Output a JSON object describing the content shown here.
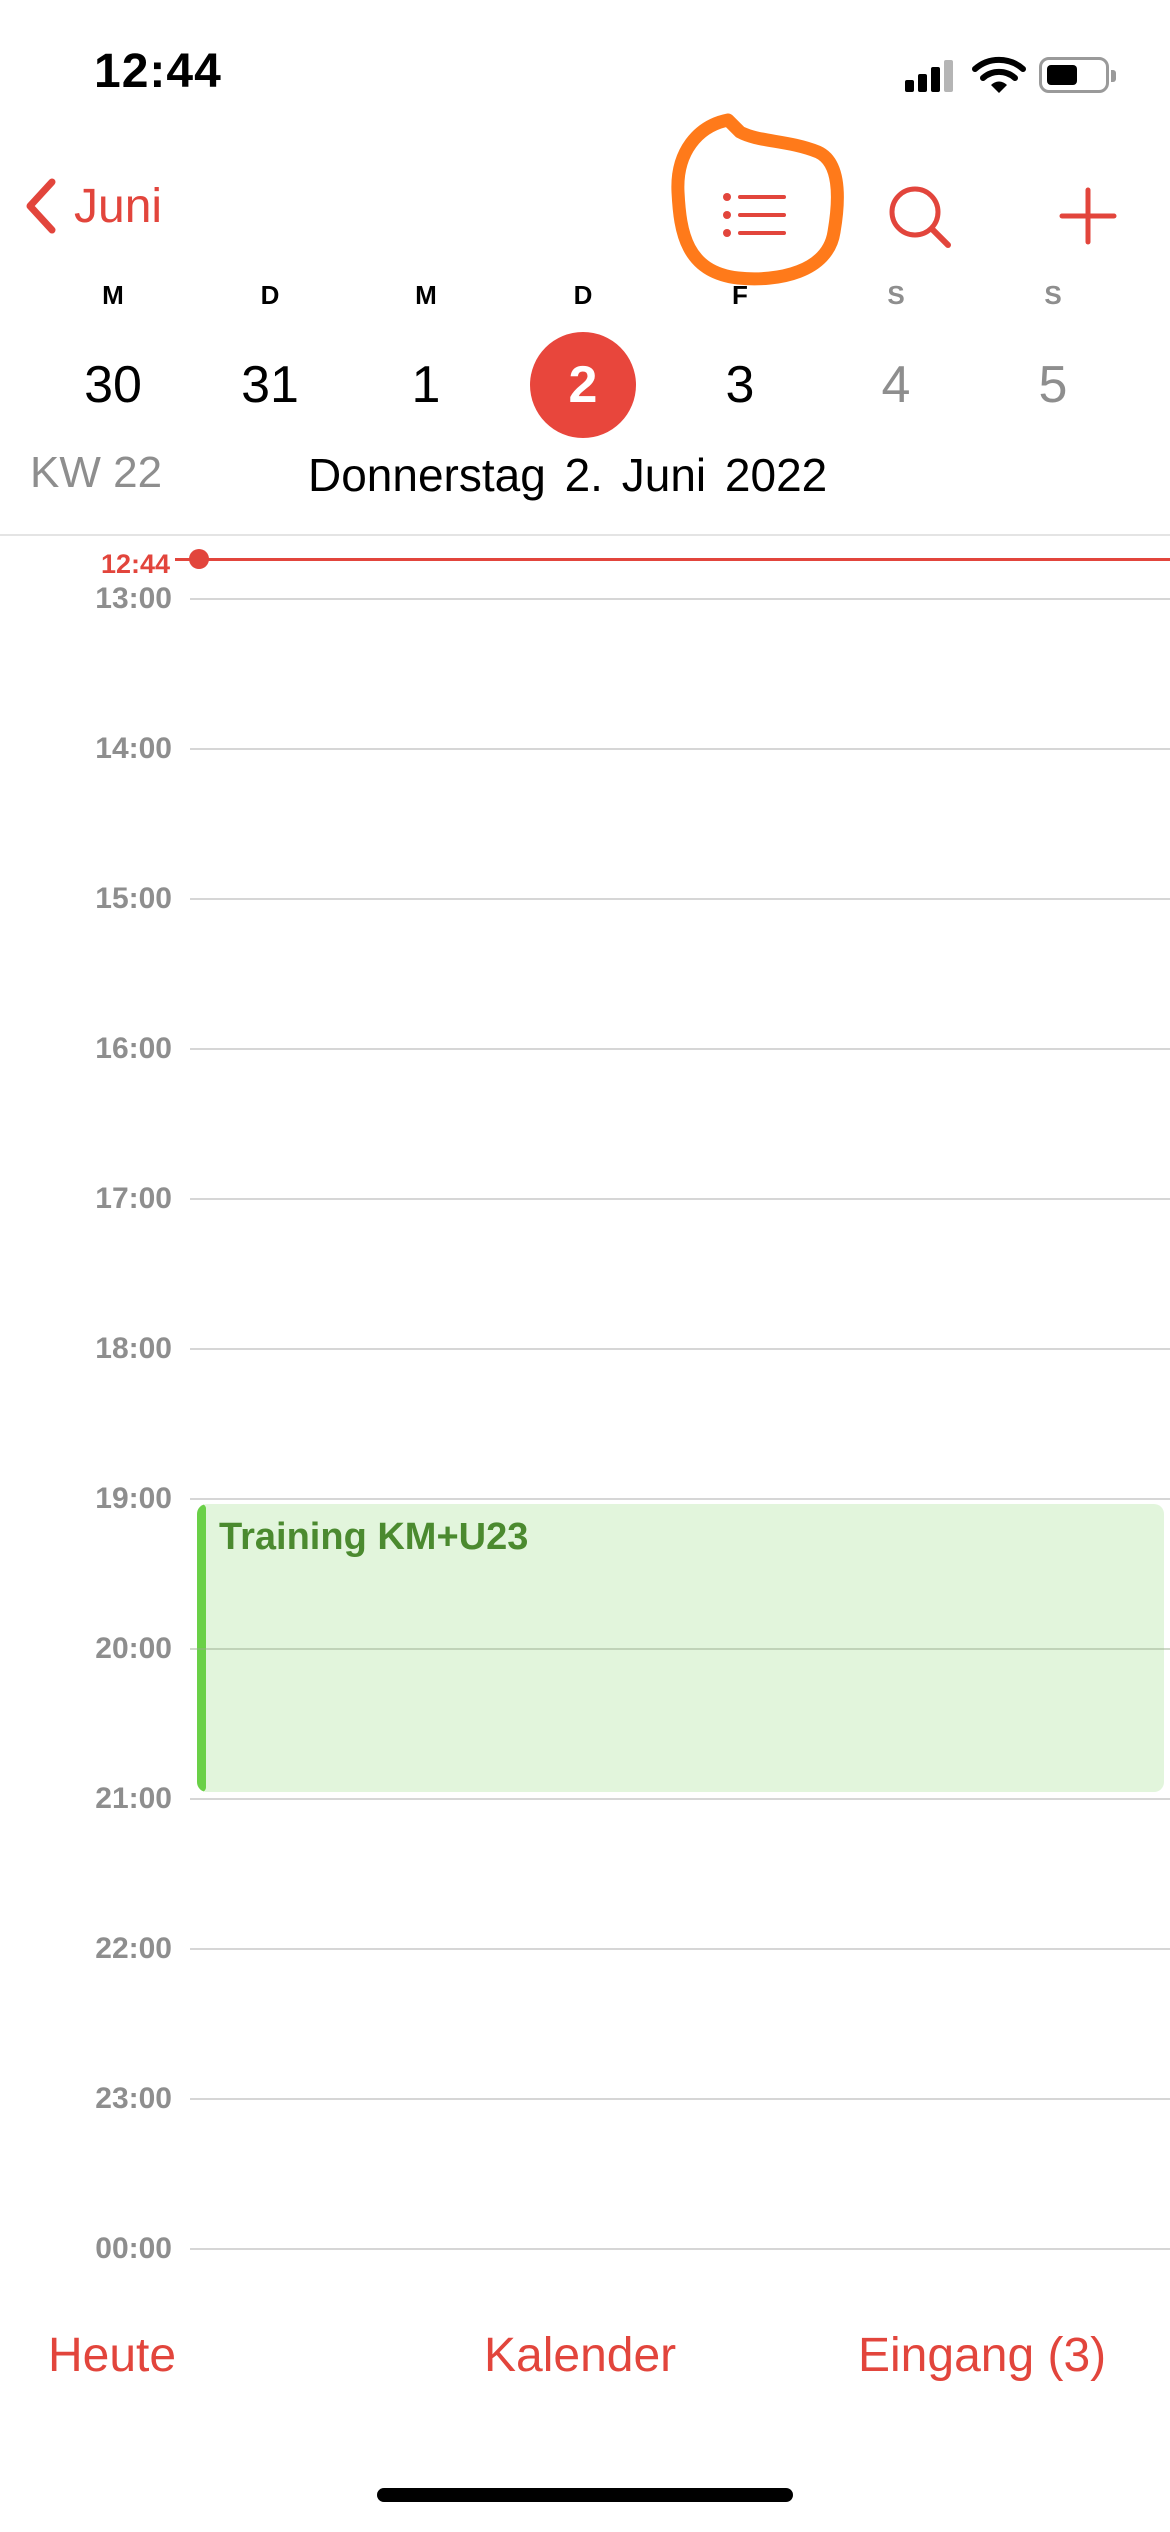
{
  "status_bar": {
    "time": "12:44",
    "icons": [
      "cellular-signal-icon",
      "wifi-icon",
      "battery-icon"
    ]
  },
  "nav": {
    "back_label": "Juni",
    "icons": [
      "chevron-left-icon",
      "list-icon",
      "search-icon",
      "plus-icon"
    ]
  },
  "week": {
    "weekdays": [
      "M",
      "D",
      "M",
      "D",
      "F",
      "S",
      "S"
    ],
    "dates": [
      "30",
      "31",
      "1",
      "2",
      "3",
      "4",
      "5"
    ],
    "selected_index": 3,
    "week_label": "KW 22",
    "date_title": "Donnerstag  2. Juni 2022"
  },
  "timeline": {
    "now_label": "12:44",
    "hours": [
      "13:00",
      "14:00",
      "15:00",
      "16:00",
      "17:00",
      "18:00",
      "19:00",
      "20:00",
      "21:00",
      "22:00",
      "23:00",
      "00:00"
    ]
  },
  "events": [
    {
      "title": "Training KM+U23",
      "start": "19:00",
      "end": "21:00"
    }
  ],
  "toolbar": {
    "today": "Heute",
    "calendars": "Kalender",
    "inbox": "Eingang (3)"
  },
  "colors": {
    "accent": "#e2453c",
    "event_bg": "#e2f5dc",
    "event_bar": "#6ad047",
    "event_text": "#4b8a2f",
    "annotation": "#ff7a1a"
  }
}
